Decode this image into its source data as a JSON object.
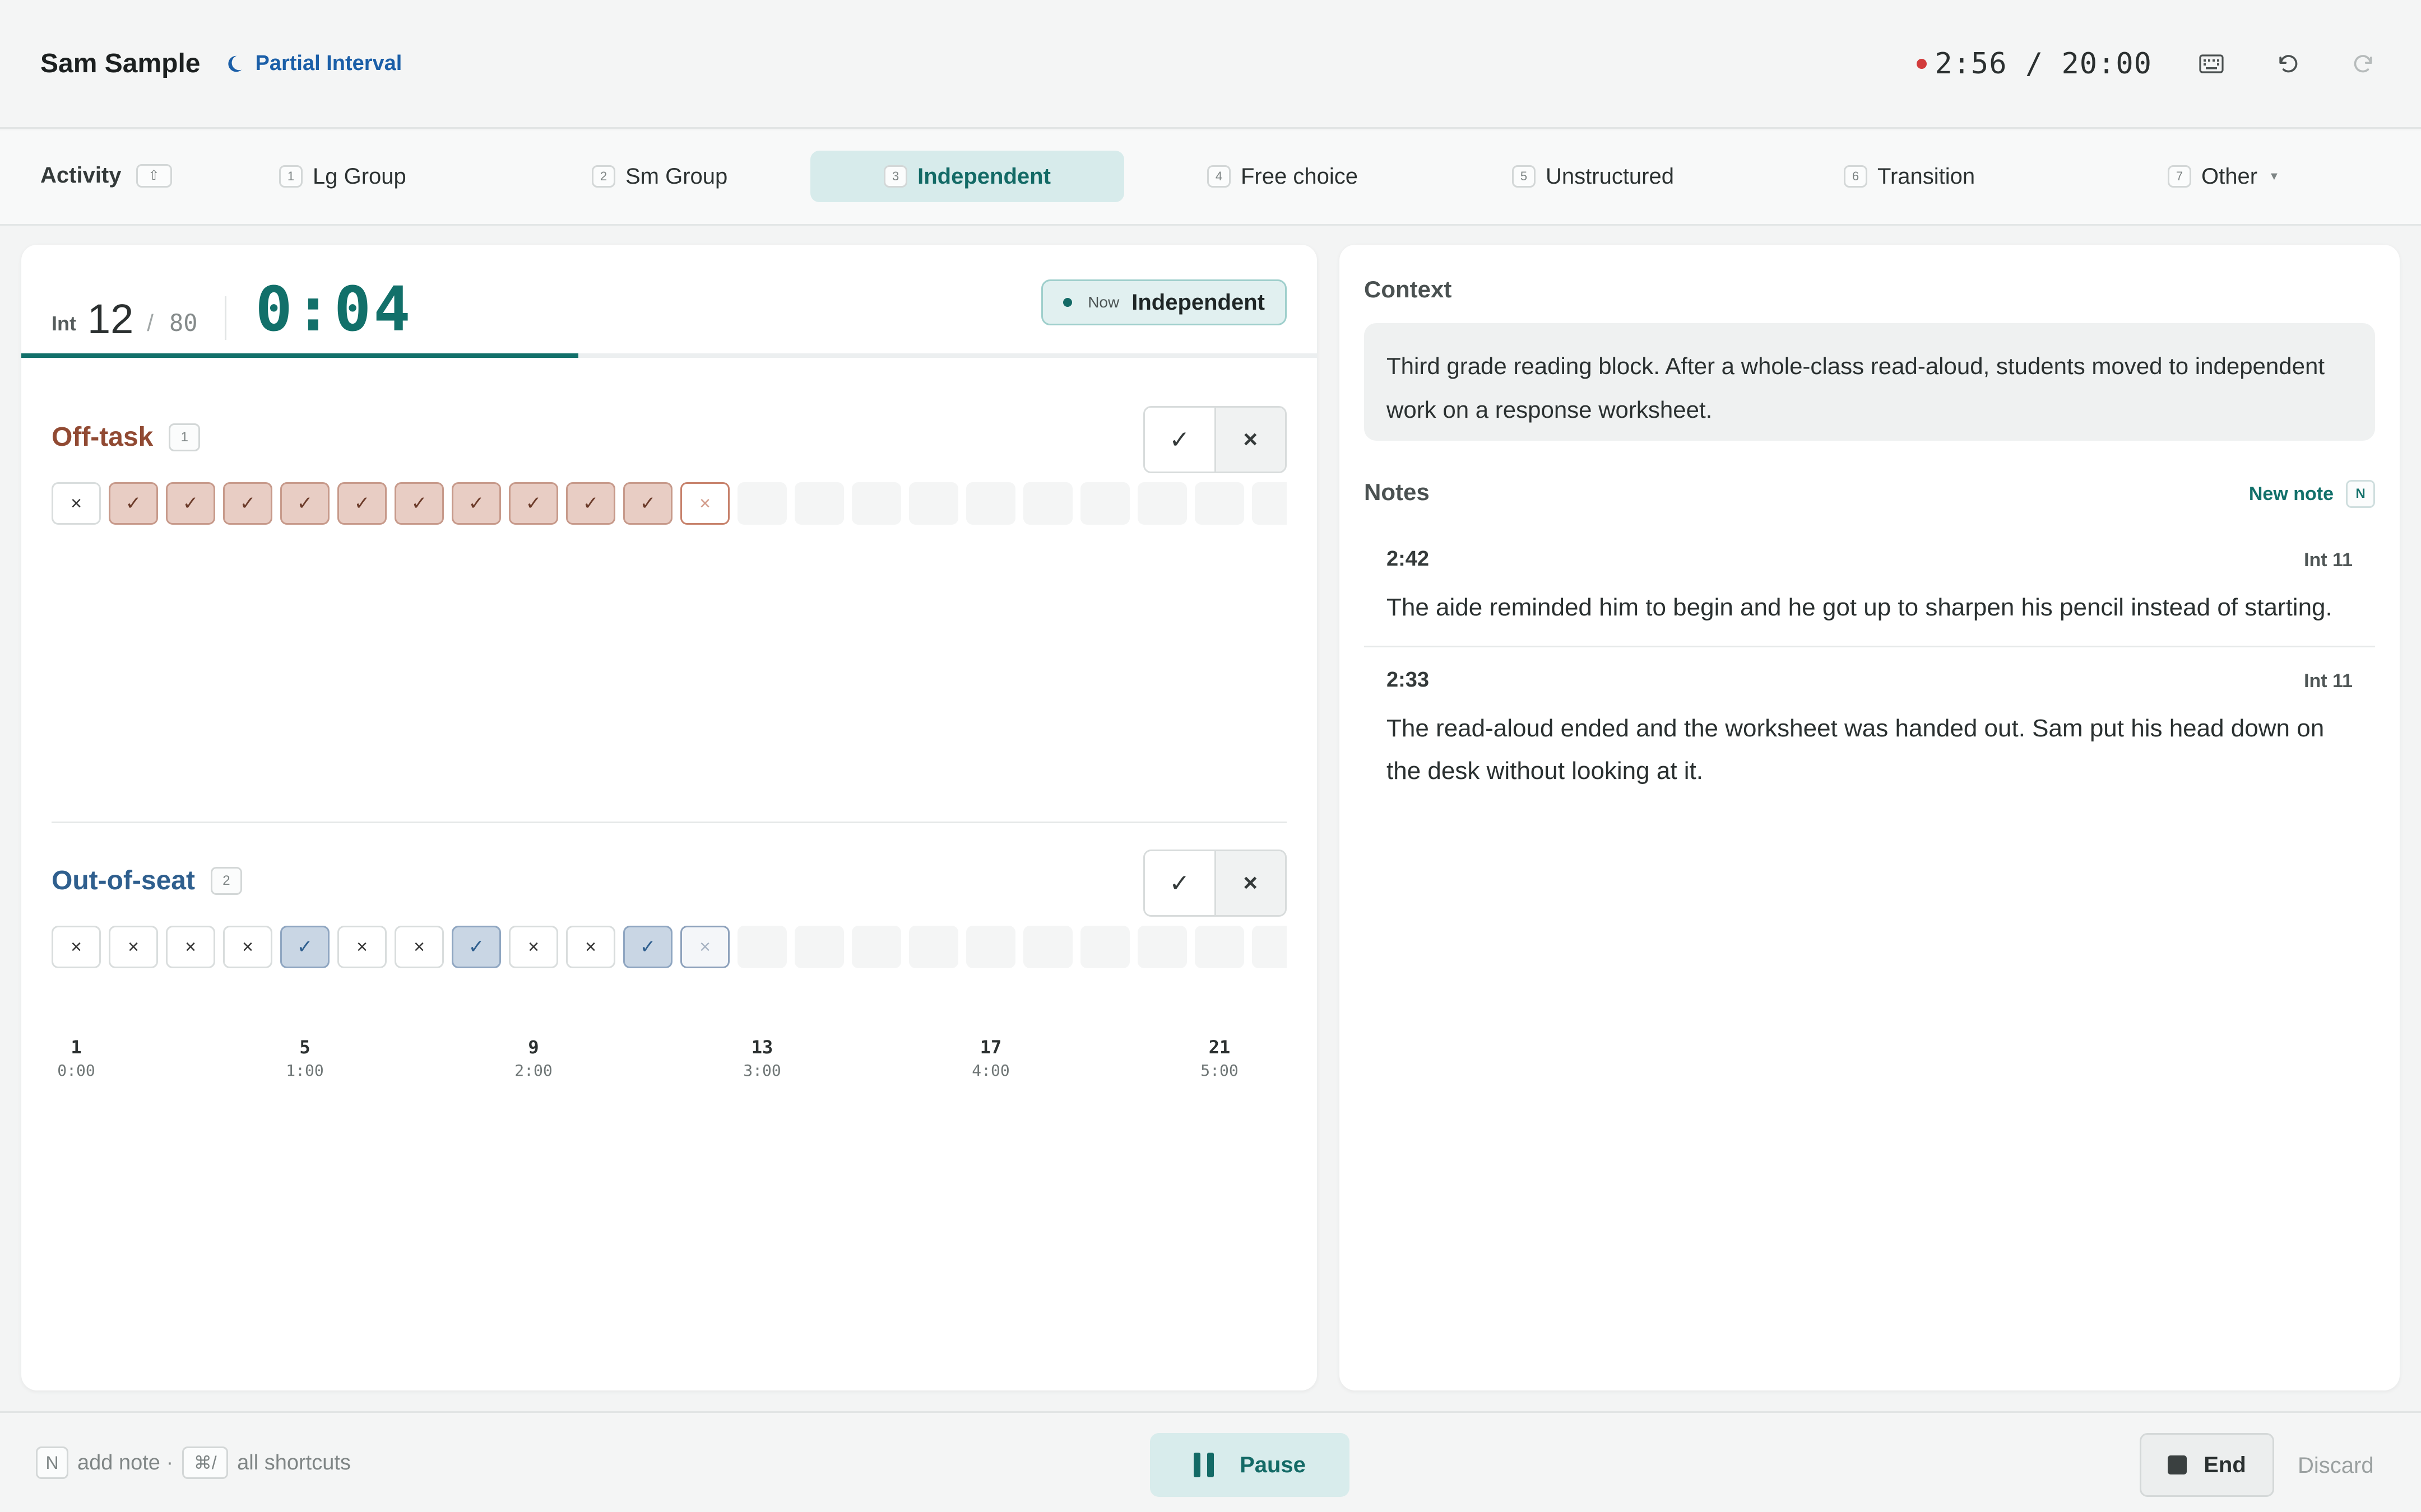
{
  "header": {
    "student_name": "Sam Sample",
    "mode_label": "Partial Interval",
    "session_clock": "2:56 / 20:00",
    "icons": [
      "moon-icon",
      "keyboard-icon",
      "undo-icon",
      "redo-icon"
    ]
  },
  "activity_bar": {
    "label": "Activity",
    "label_key": "⇧",
    "tabs": [
      {
        "key": "1",
        "label": "Lg Group"
      },
      {
        "key": "2",
        "label": "Sm Group"
      },
      {
        "key": "3",
        "label": "Independent",
        "active": true
      },
      {
        "key": "4",
        "label": "Free choice"
      },
      {
        "key": "5",
        "label": "Unstructured"
      },
      {
        "key": "6",
        "label": "Transition"
      },
      {
        "key": "7",
        "label": "Other",
        "has_dropdown": true
      }
    ]
  },
  "interval": {
    "label": "Int",
    "current": "12",
    "separator": "/",
    "total": "80",
    "elapsed": "0:04",
    "now_label": "Now",
    "now_activity": "Independent",
    "progress_fraction": 0.43
  },
  "behaviors": [
    {
      "name": "Off-task",
      "key": "1",
      "yes_label": "✓",
      "no_label": "×",
      "cells": [
        "×",
        "✓",
        "✓",
        "✓",
        "✓",
        "✓",
        "✓",
        "✓",
        "✓",
        "✓",
        "✓",
        "×",
        "",
        "",
        "",
        "",
        "",
        "",
        "",
        "",
        "",
        ""
      ]
    },
    {
      "name": "Out-of-seat",
      "key": "2",
      "yes_label": "✓",
      "no_label": "×",
      "cells": [
        "×",
        "×",
        "×",
        "×",
        "✓",
        "×",
        "×",
        "✓",
        "×",
        "×",
        "✓",
        "×",
        "",
        "",
        "",
        "",
        "",
        "",
        "",
        "",
        "",
        ""
      ]
    }
  ],
  "timeline_ticks": [
    {
      "num": "1",
      "time": "0:00"
    },
    {
      "num": "5",
      "time": "1:00"
    },
    {
      "num": "9",
      "time": "2:00"
    },
    {
      "num": "13",
      "time": "3:00"
    },
    {
      "num": "17",
      "time": "4:00"
    },
    {
      "num": "21",
      "time": "5:00"
    }
  ],
  "context": {
    "title": "Context",
    "text": "Third grade reading block. After a whole-class read-aloud, students moved to independent work on a response worksheet."
  },
  "notes": {
    "title": "Notes",
    "new_note_label": "New note",
    "new_note_key": "N",
    "items": [
      {
        "time": "2:42",
        "interval": "Int 11",
        "text": "The aide reminded him to begin and he got up to sharpen his pencil instead of starting."
      },
      {
        "time": "2:33",
        "interval": "Int 11",
        "text": "The read-aloud ended and the worksheet was handed out. Sam put his head down on the desk without looking at it."
      }
    ]
  },
  "footer": {
    "note_key": "N",
    "note_hint": "add note ·",
    "shortcut_key": "⌘/",
    "shortcut_hint": "all shortcuts",
    "pause_label": "Pause",
    "end_label": "End",
    "discard_label": "Discard"
  },
  "colors": {
    "accent": "#12706a",
    "off_task": "#914a33",
    "out_of_seat": "#2f5f8e",
    "recording": "#d23b3b",
    "mode": "#1b5fa8"
  }
}
